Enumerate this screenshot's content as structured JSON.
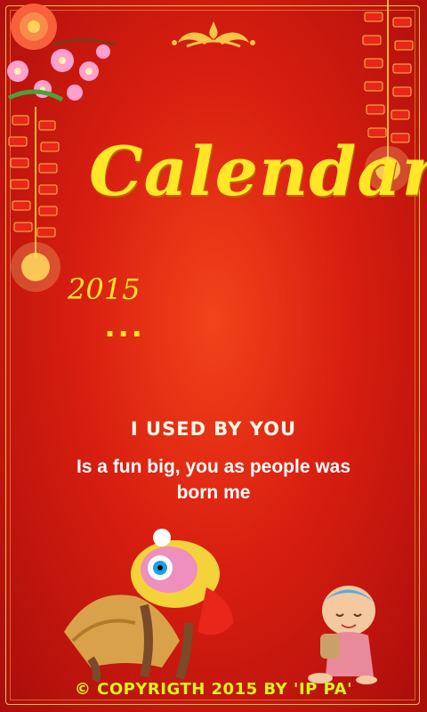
{
  "title": "Calendar",
  "year": "2015",
  "ellipsis": "...",
  "heading": "I USED BY YOU",
  "body_line1": "Is a fun big, you as people was",
  "body_line2": "born me",
  "copyright": "© COPYRIGTH 2015 BY 'IP PA'",
  "colors": {
    "background": "#d81e10",
    "title": "#ffe627",
    "copyright": "#d7f51c",
    "text": "#ffffff"
  }
}
